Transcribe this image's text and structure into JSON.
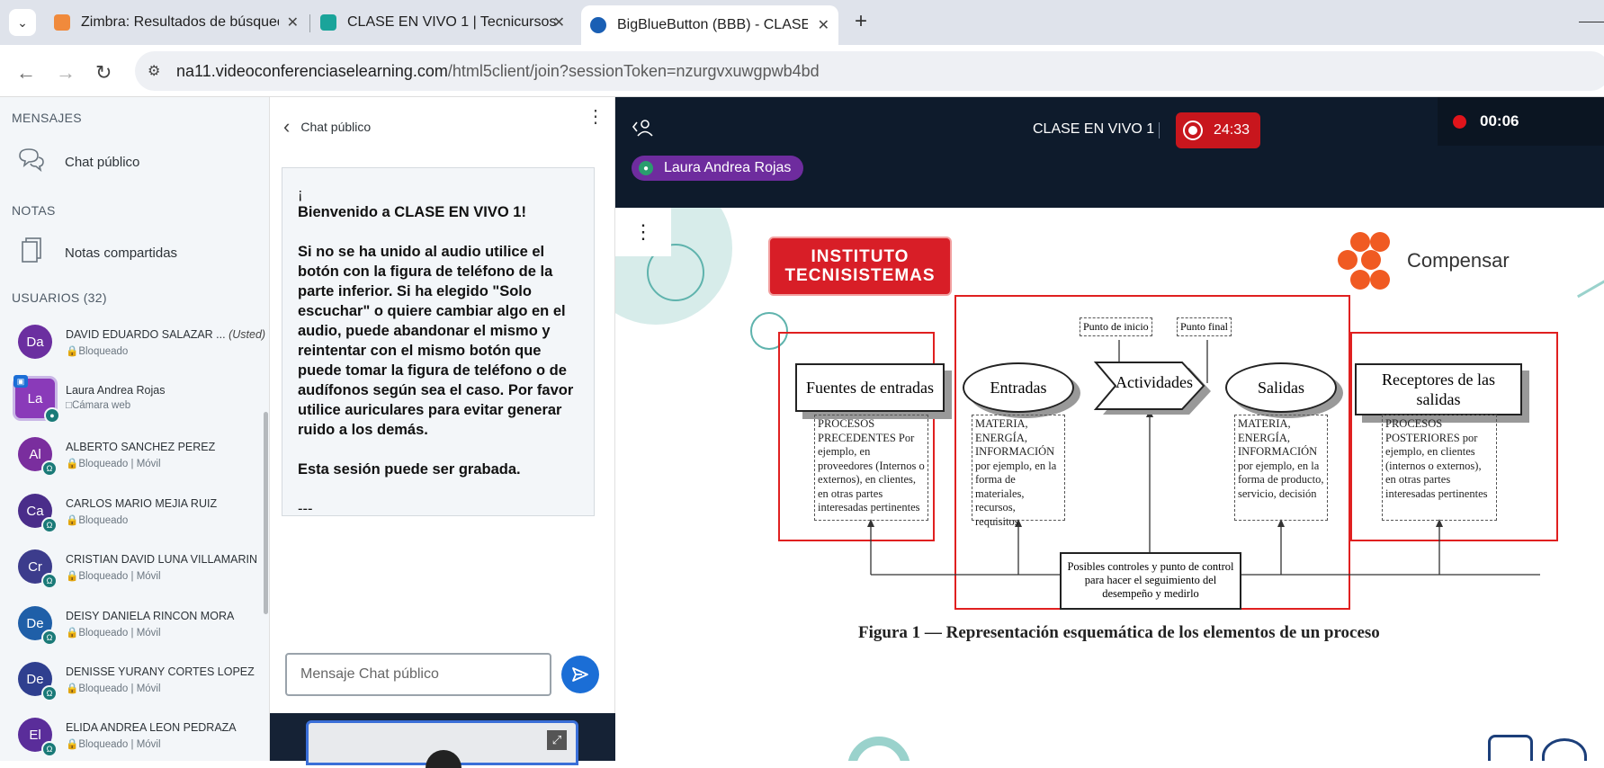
{
  "browser": {
    "tabs": [
      {
        "title": "Zimbra: Resultados de búsqued",
        "favicon_color": "#f08a3c"
      },
      {
        "title": "CLASE EN VIVO 1 | Tecnicursos",
        "favicon_color": "#1aa49a"
      },
      {
        "title": "BigBlueButton (BBB) - CLASE EN",
        "favicon_color": "#1a5fb4"
      }
    ],
    "url_host": "na11.videoconferenciaselearning.com",
    "url_path": "/html5client/join?sessionToken=nzurgvxuwgpwb4bd"
  },
  "sidebar": {
    "messages_header": "MENSAJES",
    "public_chat_label": "Chat público",
    "notes_header": "NOTAS",
    "shared_notes_label": "Notas compartidas",
    "users_header": "USUARIOS (32)",
    "users": [
      {
        "initials": "Da",
        "name": "DAVID EDUARDO SALAZAR ...",
        "you": "(Usted)",
        "status": "Bloqueado",
        "color": "#6b2fa0"
      },
      {
        "initials": "La",
        "name": "Laura Andrea Rojas",
        "status": "Cámara web",
        "color": "#8a3ab9"
      },
      {
        "initials": "Al",
        "name": "ALBERTO SANCHEZ PEREZ",
        "status": "Bloqueado | Móvil",
        "color": "#7a2e9e"
      },
      {
        "initials": "Ca",
        "name": "CARLOS MARIO MEJIA RUIZ",
        "status": "Bloqueado",
        "color": "#4a2d8a"
      },
      {
        "initials": "Cr",
        "name": "CRISTIAN DAVID LUNA VILLAMARIN",
        "status": "Bloqueado | Móvil",
        "color": "#3c3c8c"
      },
      {
        "initials": "De",
        "name": "DEISY DANIELA RINCON MORA",
        "status": "Bloqueado | Móvil",
        "color": "#1f5fa8"
      },
      {
        "initials": "De",
        "name": "DENISSE YURANY CORTES LOPEZ",
        "status": "Bloqueado | Móvil",
        "color": "#2f3f8f"
      },
      {
        "initials": "El",
        "name": "ELIDA ANDREA LEON PEDRAZA",
        "status": "Bloqueado | Móvil",
        "color": "#5a2d9a"
      }
    ]
  },
  "chat": {
    "title": "Chat público",
    "welcome_line0": "¡",
    "welcome_prefix": "Bienvenido a ",
    "welcome_room": "CLASE EN VIVO 1",
    "welcome_suffix": "!",
    "welcome_body": "Si no se ha unido al audio utilice el botón con la figura de teléfono de la parte inferior. Si ha elegido \"Solo escuchar\" o quiere cambiar algo en el audio, puede abandonar el mismo y reintentar con el mismo botón que puede tomar la figura de teléfono o de audífonos según sea el caso. Por favor utilice auriculares para evitar generar ruido a los demás.",
    "recording_note": "Esta sesión puede ser grabada.",
    "separator": "---",
    "input_placeholder": "Mensaje Chat público"
  },
  "meeting": {
    "title": "CLASE EN VIVO 1",
    "record_time": "24:33",
    "timer": "00:06",
    "talker": "Laura Andrea Rojas"
  },
  "slide": {
    "logo_left_line1": "INSTITUTO",
    "logo_left_line2": "TECNISISTEMAS",
    "logo_right": "Compensar",
    "boxes": {
      "sources": "Fuentes de entradas",
      "inputs": "Entradas",
      "activities": "Actividades",
      "outputs": "Salidas",
      "receivers": "Receptores de las salidas",
      "start_point": "Punto de inicio",
      "end_point": "Punto final",
      "controls": "Posibles controles y punto de control para hacer el seguimiento del desempeño y medirlo"
    },
    "notes": {
      "precedents": "PROCESOS PRECEDENTES Por ejemplo, en proveedores (Internos o externos), en clientes, en otras partes interesadas pertinentes",
      "inputs": "MATERIA, ENERGÍA, INFORMACIÓN por ejemplo, en la forma de materiales, recursos, requisitos",
      "outputs": "MATERIA, ENERGÍA, INFORMACIÓN por ejemplo, en la forma de producto, servicio, decisión",
      "later": "PROCESOS POSTERIORES por ejemplo, en clientes (internos o externos), en otras partes interesadas pertinentes"
    },
    "caption": "Figura 1 — Representación esquemática de los elementos de un proceso"
  }
}
